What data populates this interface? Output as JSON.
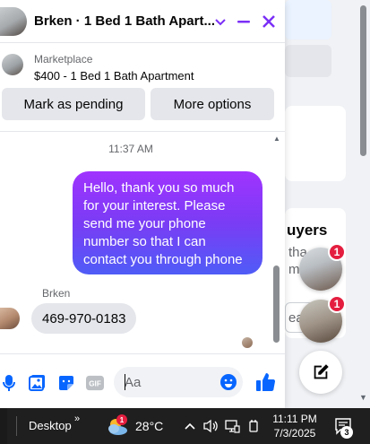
{
  "chat": {
    "title": "Brken · 1 Bed 1 Bath Apart...",
    "listing": {
      "source": "Marketplace",
      "title": "$400 - 1 Bed 1 Bath Apartment"
    },
    "actions": {
      "pending_label": "Mark as pending",
      "more_label": "More options"
    },
    "timestamp": "11:37 AM",
    "messages": [
      {
        "direction": "out",
        "text": "Hello, thank you so much for your interest. Please send me your phone number so that I can contact you through phone"
      },
      {
        "direction": "in",
        "sender": "Brken",
        "text": "469-970-0183"
      }
    ],
    "composer": {
      "placeholder": "Aa",
      "gif_label": "GIF"
    },
    "accent_color": "#7b2ff7"
  },
  "background": {
    "heading": "uyers",
    "line1": "tha",
    "line2": "mo",
    "line3": "ea"
  },
  "chat_heads": [
    {
      "badge": "1"
    },
    {
      "badge": "1"
    }
  ],
  "taskbar": {
    "desktop_label": "Desktop",
    "weather_badge": "1",
    "temperature": "28°C",
    "time": "11:11 PM",
    "date": "7/3/2025",
    "notification_count": "3"
  }
}
